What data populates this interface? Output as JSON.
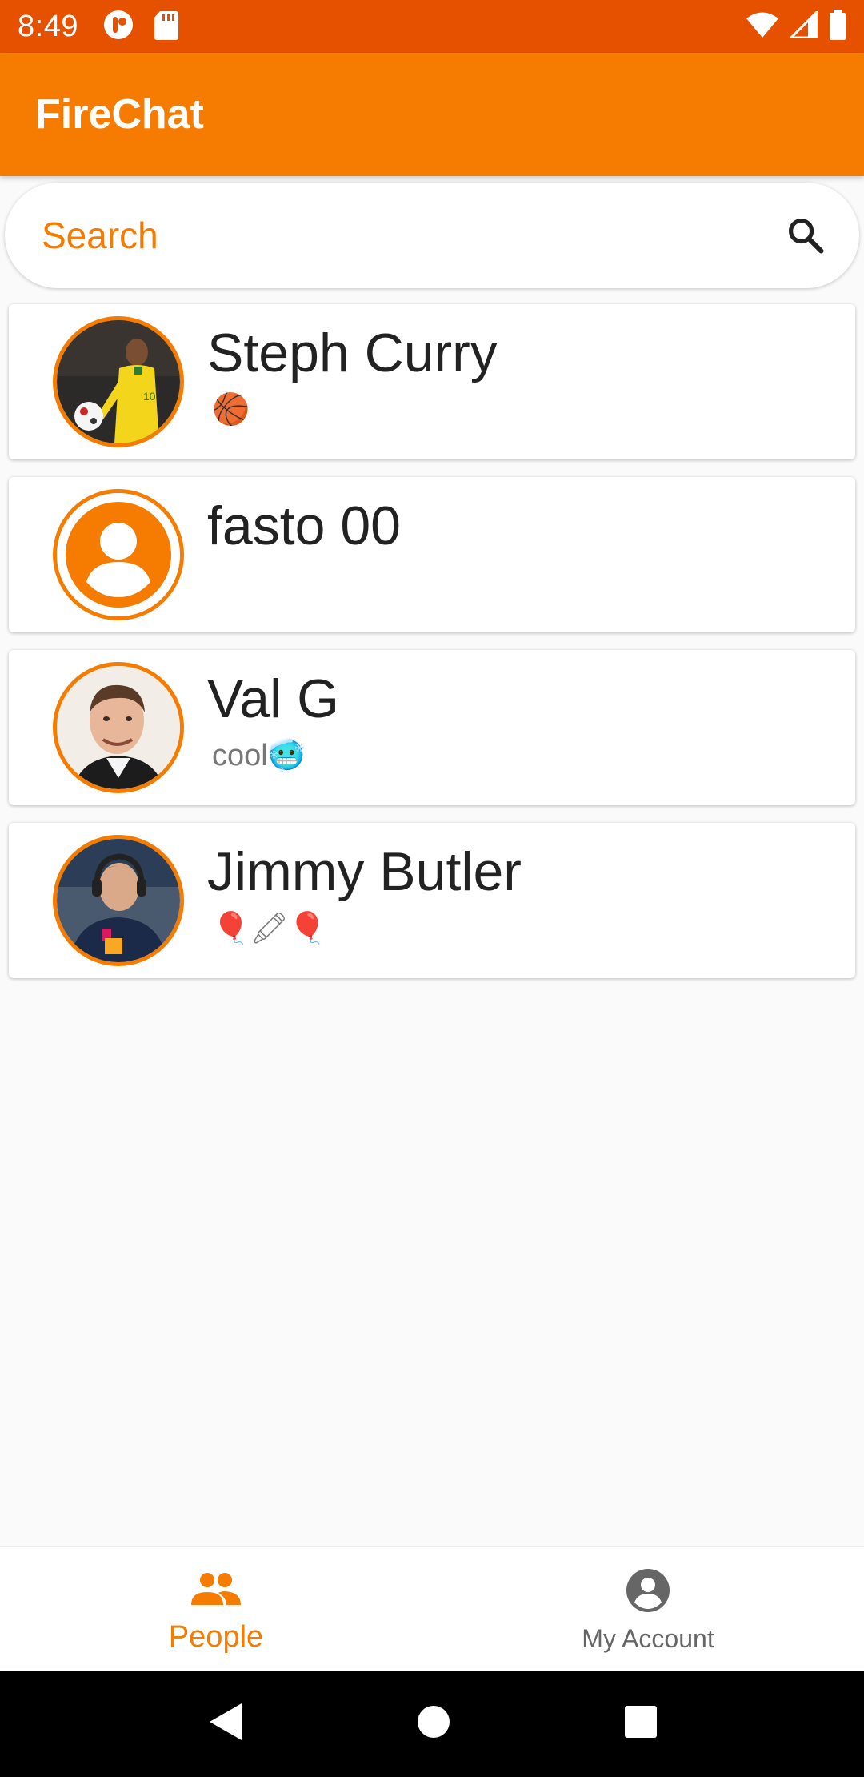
{
  "status_bar": {
    "time": "8:49",
    "left_icons": [
      "notification-app-icon",
      "sd-card-icon"
    ],
    "right_icons": [
      "wifi-icon",
      "cellular-signal-icon",
      "battery-icon"
    ]
  },
  "app_bar": {
    "title": "FireChat"
  },
  "search": {
    "placeholder": "Search",
    "icon": "search-icon"
  },
  "people": [
    {
      "name": "Steph Curry",
      "status": "🏀",
      "avatar": "photo"
    },
    {
      "name": "fasto 00",
      "status": "",
      "avatar": "default-person-icon"
    },
    {
      "name": "Val G",
      "status": "cool🥶",
      "avatar": "photo"
    },
    {
      "name": "Jimmy Butler",
      "status": "🎈🖍🎈",
      "avatar": "photo"
    }
  ],
  "bottom_nav": {
    "items": [
      {
        "label": "People",
        "icon": "people-icon",
        "active": true
      },
      {
        "label": "My Account",
        "icon": "account-circle-icon",
        "active": false
      }
    ]
  },
  "system_nav": {
    "icons": [
      "back-icon",
      "home-icon",
      "recents-icon"
    ]
  },
  "colors": {
    "status_bar": "#e65100",
    "primary": "#f57c00",
    "background": "#fafafa",
    "inactive": "#666666"
  }
}
